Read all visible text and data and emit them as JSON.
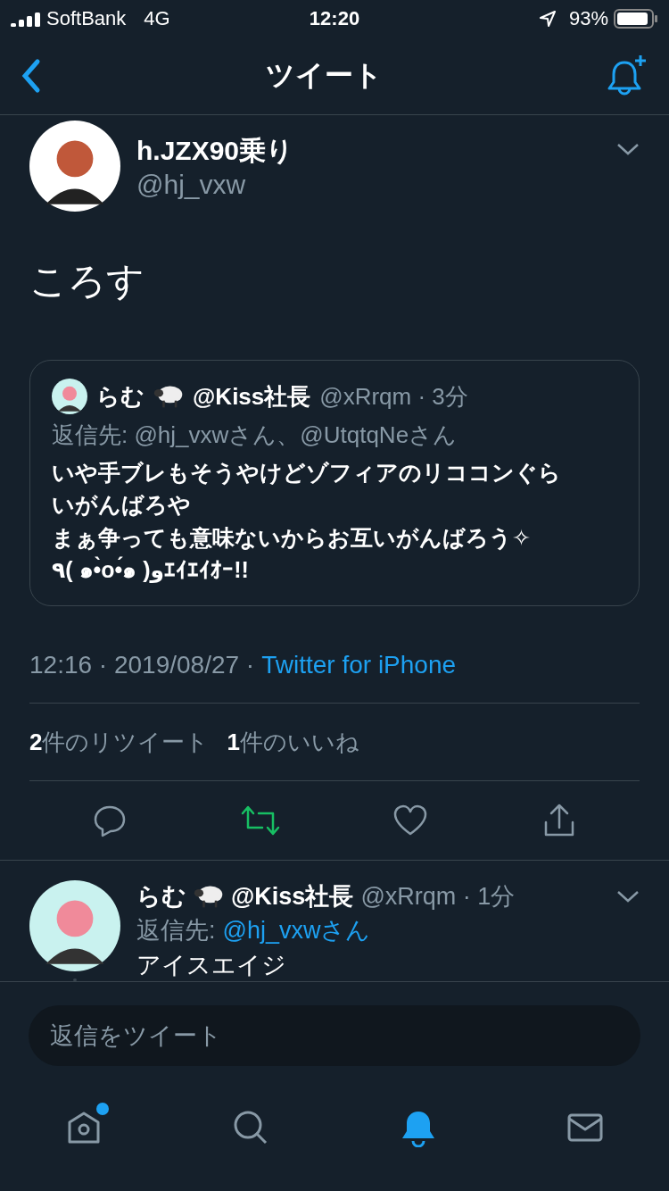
{
  "status_bar": {
    "carrier": "SoftBank",
    "network": "4G",
    "time": "12:20",
    "battery": "93%"
  },
  "nav": {
    "title": "ツイート"
  },
  "tweet": {
    "name": "h.JZX90乗り",
    "handle": "@hj_vxw",
    "text": "ころす",
    "quote": {
      "name": "らむ",
      "name_suffix": "@Kiss社長",
      "handle_time": "@xRrqm · 3分",
      "reply_label": "返信先: @hj_vxwさん、@UtqtqNeさん",
      "lines": [
        "いや手ブレもそうやけどゾフィアのリココンぐら",
        "いがんばろや",
        "まぁ争っても意味ないからお互いがんばろう✧",
        "٩( ๑•̀o•́๑ )وｴｲｴｲｵｰ!!"
      ]
    },
    "meta": "12:16 · 2019/08/27 ·",
    "source": "Twitter for iPhone",
    "stats": [
      {
        "count": "2",
        "label": "件のリツイート"
      },
      {
        "count": "1",
        "label": "件のいいね"
      }
    ],
    "actions": [
      {
        "kind": "reply",
        "active": false
      },
      {
        "kind": "retweet",
        "active": true
      },
      {
        "kind": "like",
        "active": false
      },
      {
        "kind": "share",
        "active": false
      }
    ]
  },
  "reply": {
    "name": "らむ",
    "name_suffix": "@Kiss社長",
    "handle_time": "@xRrqm · 1分",
    "reply_label": "返信先:",
    "reply_to": "@hj_vxwさん",
    "text": "アイスエイジ"
  },
  "composer": {
    "placeholder": "返信をツイート"
  },
  "tabs": [
    {
      "kind": "home",
      "selected": false,
      "badge": true
    },
    {
      "kind": "search",
      "selected": false,
      "badge": false
    },
    {
      "kind": "notifications",
      "selected": true,
      "badge": false
    },
    {
      "kind": "messages",
      "selected": false,
      "badge": false
    }
  ]
}
